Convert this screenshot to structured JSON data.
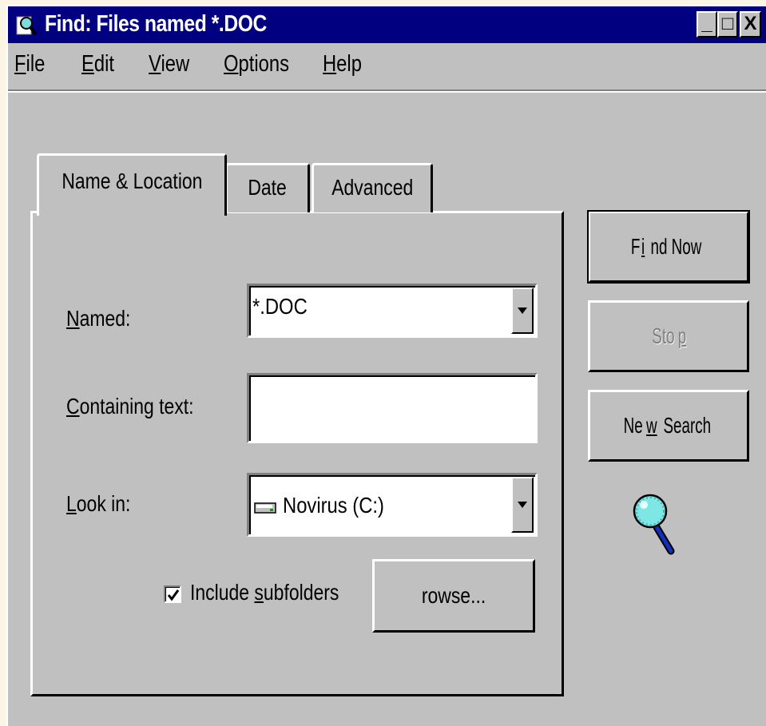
{
  "window": {
    "title": "Find: Files named *.DOC",
    "controls": {
      "minimize": "_",
      "maximize": "□",
      "close": "X"
    }
  },
  "menu": [
    {
      "first": "F",
      "rest": "ile"
    },
    {
      "first": "E",
      "rest": "dit"
    },
    {
      "first": "V",
      "rest": "iew"
    },
    {
      "first": "O",
      "rest": "ptions"
    },
    {
      "first": "H",
      "rest": "elp"
    }
  ],
  "tabs": {
    "name_location": "Name & Location",
    "date": "Date",
    "advanced": "Advanced"
  },
  "form": {
    "named": {
      "label_u": "N",
      "label_rest": "amed:",
      "value": "*.DOC"
    },
    "containing": {
      "label_u": "C",
      "label_rest": "ontaining text:",
      "value": ""
    },
    "look_in": {
      "label_u": "L",
      "label_rest": "ook in:",
      "value": "Novirus (C:)",
      "icon": "drive-icon"
    },
    "include_subfolders": {
      "pre": "Include ",
      "u": "s",
      "rest": "ubfolders",
      "checked": true
    },
    "browse": "rowse..."
  },
  "buttons": {
    "find_now": {
      "pre": "F",
      "u": "i",
      "rest": "nd Now"
    },
    "stop": {
      "pre": "Sto",
      "u": "p",
      "rest": ""
    },
    "new_search": {
      "pre": "Ne",
      "u": "w",
      "rest": " Search"
    }
  },
  "colors": {
    "titlebar": "#000080",
    "face": "#c0c0c0",
    "disabled_text": "#808080"
  },
  "icons": {
    "app": "find-app-icon",
    "magnifier": "magnifier-icon"
  }
}
